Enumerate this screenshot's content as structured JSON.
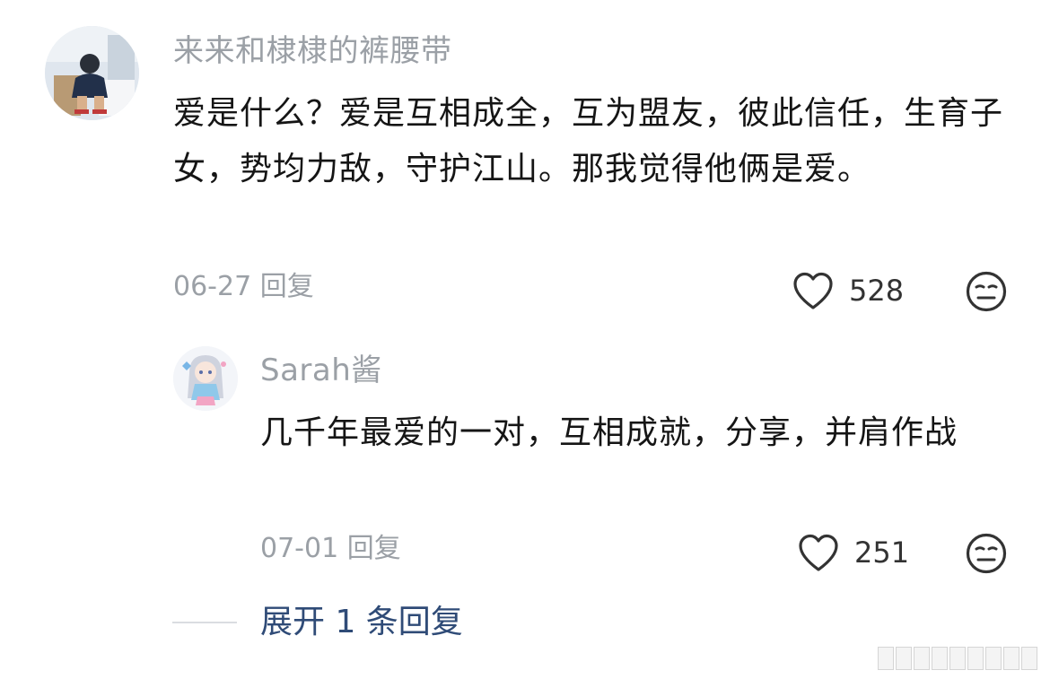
{
  "comment": {
    "username": "来来和棣棣的裤腰带",
    "text": "爱是什么？爱是互相成全，互为盟友，彼此信任，生育子女，势均力敌，守护江山。那我觉得他俩是爱。",
    "date": "06-27",
    "reply_label": "回复",
    "likes": "528",
    "avatar_icon": "user-photo-avatar",
    "like_icon": "heart-outline-icon",
    "reaction_icon": "meh-face-icon"
  },
  "reply": {
    "username": "Sarah酱",
    "text": "几千年最爱的一对，互相成就，分享，并肩作战",
    "date": "07-01",
    "reply_label": "回复",
    "likes": "251",
    "avatar_icon": "anime-girl-avatar",
    "like_icon": "heart-outline-icon",
    "reaction_icon": "meh-face-icon"
  },
  "expand": {
    "label": "展开 1 条回复"
  },
  "colors": {
    "meta_gray": "#9ba0a6",
    "text": "#151515",
    "link_blue": "#2f4b77"
  }
}
